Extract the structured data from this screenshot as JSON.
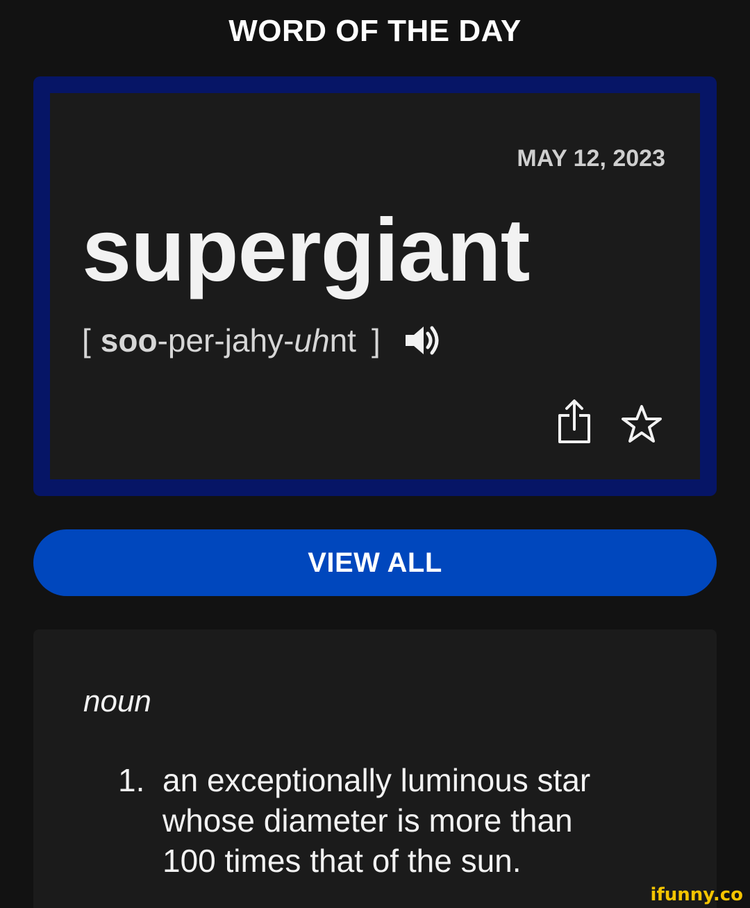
{
  "header": {
    "title": "WORD OF THE DAY"
  },
  "wotd": {
    "date": "MAY 12, 2023",
    "word": "supergiant",
    "pronunciation": {
      "open_bracket": "[",
      "stressed": "soo",
      "middle": "-per-jahy-",
      "italic": "uh",
      "end": "nt",
      "close_bracket": "]"
    },
    "icons": {
      "audio": "speaker-icon",
      "share": "share-icon",
      "favorite": "star-icon"
    }
  },
  "view_all_button": {
    "label": "VIEW ALL"
  },
  "definition": {
    "part_of_speech": "noun",
    "items": [
      {
        "number": "1.",
        "text": "an exceptionally luminous star whose diameter is more than 100 times that of the sun."
      }
    ]
  },
  "watermark": "ifunny.co",
  "colors": {
    "background": "#121212",
    "card_background": "#1b1b1b",
    "card_border": "#061566",
    "button": "#0047bd",
    "watermark": "#f5c400"
  }
}
